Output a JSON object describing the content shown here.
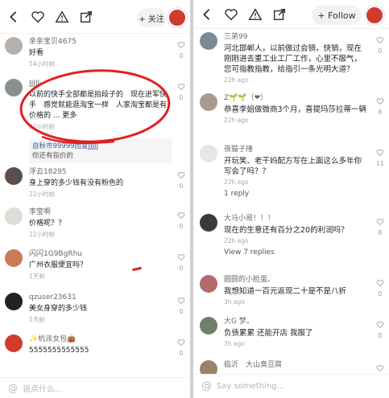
{
  "left": {
    "follow_label": "+ 关注",
    "input_placeholder": "说点什么...",
    "comments": [
      {
        "user": "亲亲宝贝4675",
        "text": "好看",
        "time": "14小时前",
        "likes": "0"
      },
      {
        "user": "JJJJJ···",
        "text": "以前的快手全部都是拍段子的　现在进军快手　感觉就能逛淘宝一样　人家淘宝都是有价格的 ... 更多",
        "time": "22小时前",
        "likes": "0",
        "reply": {
          "user": "自秋市99999回复JJJJJ",
          "text": "你还有指价的"
        }
      },
      {
        "user": "浮云18295",
        "text": "身上穿的多少钱有没有粉色的",
        "time": "22小时前",
        "likes": "0"
      },
      {
        "user": "李莹啊",
        "text": "价格呢？？",
        "time": "22小时前",
        "likes": "0"
      },
      {
        "user": "闪闪1G9BgRhu",
        "text": "广州衣服便宜吗？",
        "time": "1天前",
        "likes": "0"
      },
      {
        "user": "qzuser23631",
        "text": "美女身穿的多少钱",
        "time": "1天前",
        "likes": "0"
      },
      {
        "user": "✨杭派女包👜",
        "text": "5555555555555",
        "time": "",
        "likes": "0"
      }
    ]
  },
  "right": {
    "follow_label": "+ Follow",
    "input_placeholder": "Say something...",
    "comments": [
      {
        "user": "三弟99",
        "text": "河北邯郸人，以前做过会销，快销，现在刚刚进去重工业工厂工作，心里不服气，您可指教指教，给指引一条光明大道？",
        "time": "22h ago",
        "likes": "0"
      },
      {
        "user": "Z🌱🌱（❤）",
        "text": "恭喜李姐做微商3个月，喜提玛莎拉蒂一辆",
        "time": "22h ago",
        "likes": "6"
      },
      {
        "user": "夜猫子捶",
        "text": "开玩笑、老干妈配方写在上面这么多年你写会了吗？？",
        "time": "22h ago",
        "likes": "11",
        "view_replies": "1 reply"
      },
      {
        "user": "大马小哥！！！",
        "text": "现在的生意还有百分之20的利润吗？",
        "time": "22h ago",
        "likes": "8",
        "view_replies": "View 7 replies"
      },
      {
        "user": "圆圆的小脸蛋。",
        "text": "我想知道一百元返现二十是不是八折",
        "time": "3h ago",
        "likes": "0"
      },
      {
        "user": "大G 梦。",
        "text": "负债累累 还能开店 我服了",
        "time": "3h ago",
        "likes": "0"
      },
      {
        "user": "临沂　大山臭豆腐",
        "text": "",
        "time": "",
        "likes": "0"
      }
    ]
  },
  "colors": {
    "accent_red": "#e02020",
    "avatar_red": "#d23a2f"
  },
  "icons": [
    "back-icon",
    "heart-icon",
    "warning-icon",
    "share-icon",
    "at-icon"
  ]
}
